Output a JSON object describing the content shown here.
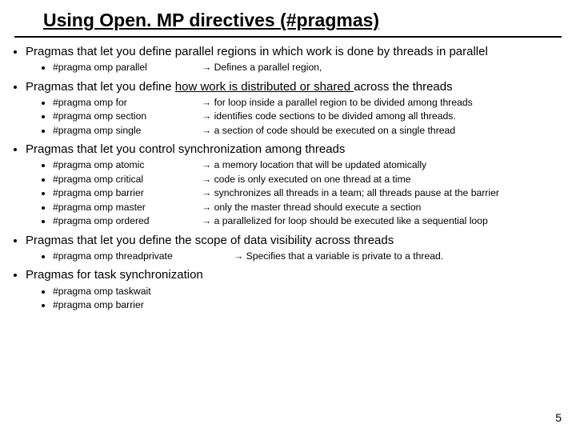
{
  "title": "Using Open. MP directives (#pragmas)",
  "sections": [
    {
      "heading": "Pragmas that let you define parallel regions in which work is done by threads in parallel",
      "heading_underlined_tail": "",
      "items": [
        {
          "lhs": "#pragma omp parallel",
          "rhs": "Defines a parallel region,"
        }
      ],
      "wide": false
    },
    {
      "heading": "Pragmas that let you define ",
      "heading_underlined_tail": "how work is distributed or shared ",
      "heading_after": "across the threads",
      "items": [
        {
          "lhs": "#pragma omp for",
          "rhs": "for loop inside a parallel region to be divided among threads"
        },
        {
          "lhs": "#pragma omp section",
          "rhs": "identifies code sections to be divided among all threads."
        },
        {
          "lhs": "#pragma omp single",
          "rhs": "a section of code should be executed on a single thread"
        }
      ],
      "wide": false
    },
    {
      "heading": "Pragmas that let you control synchronization among threads",
      "heading_underlined_tail": "",
      "items": [
        {
          "lhs": "#pragma omp atomic",
          "rhs": "a memory location that will be updated atomically"
        },
        {
          "lhs": "#pragma omp critical",
          "rhs": "code is only executed on one thread at a time"
        },
        {
          "lhs": "#pragma omp barrier",
          "rhs": "synchronizes all threads in a team; all threads pause at the barrier"
        },
        {
          "lhs": "#pragma omp master",
          "rhs": "only the master thread should execute a section"
        },
        {
          "lhs": "#pragma omp ordered",
          "rhs": "a parallelized for loop should be executed like a sequential loop"
        }
      ],
      "wide": false
    },
    {
      "heading": "Pragmas that let you define the scope of data visibility across threads",
      "heading_underlined_tail": "",
      "items": [
        {
          "lhs": "#pragma omp threadprivate",
          "rhs": "Specifies that a variable is private to a thread."
        }
      ],
      "wide": true
    },
    {
      "heading": "Pragmas for task synchronization",
      "heading_underlined_tail": "",
      "items": [
        {
          "lhs": "#pragma omp taskwait",
          "rhs": ""
        },
        {
          "lhs": "#pragma omp barrier",
          "rhs": ""
        }
      ],
      "wide": false
    }
  ],
  "page_number": "5"
}
